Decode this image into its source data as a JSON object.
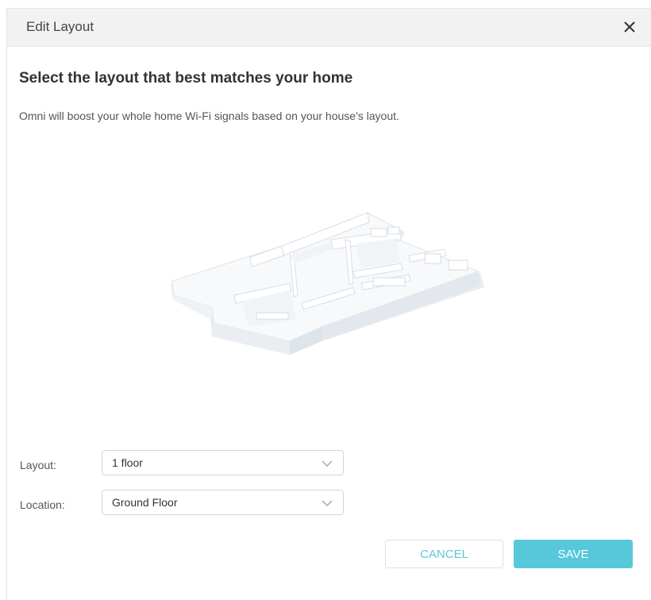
{
  "dialog": {
    "title": "Edit Layout",
    "close_icon": "close-icon"
  },
  "content": {
    "heading": "Select the layout that best matches your home",
    "description": "Omni will boost your whole home Wi-Fi signals based on your house's layout.",
    "illustration_icon": "floor-plan-3d-icon"
  },
  "form": {
    "layout": {
      "label": "Layout:",
      "value": "1 floor"
    },
    "location": {
      "label": "Location:",
      "value": "Ground Floor"
    }
  },
  "buttons": {
    "cancel": "CANCEL",
    "save": "SAVE"
  },
  "colors": {
    "accent": "#56c8da",
    "header_bg": "#f2f2f2"
  }
}
